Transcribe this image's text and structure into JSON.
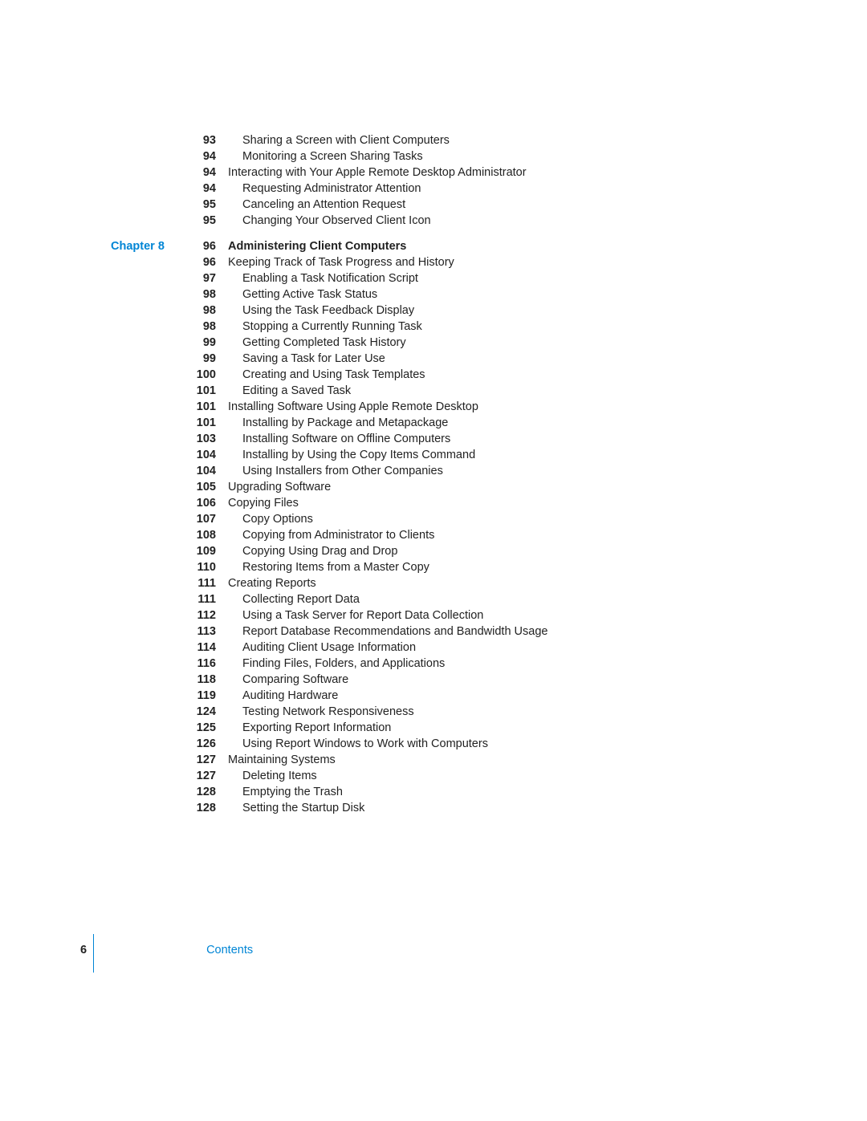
{
  "preEntries": [
    {
      "page": "93",
      "title": "Sharing a Screen with Client Computers",
      "indent": 2
    },
    {
      "page": "94",
      "title": "Monitoring a Screen Sharing Tasks",
      "indent": 2
    },
    {
      "page": "94",
      "title": "Interacting with Your Apple Remote Desktop Administrator",
      "indent": 1
    },
    {
      "page": "94",
      "title": "Requesting Administrator Attention",
      "indent": 2
    },
    {
      "page": "95",
      "title": "Canceling an Attention Request",
      "indent": 2
    },
    {
      "page": "95",
      "title": "Changing Your Observed Client Icon",
      "indent": 2
    }
  ],
  "chapter": {
    "label": "Chapter 8",
    "page": "96",
    "title": "Administering Client Computers"
  },
  "entries": [
    {
      "page": "96",
      "title": "Keeping Track of Task Progress and History",
      "indent": 1
    },
    {
      "page": "97",
      "title": "Enabling a Task Notification Script",
      "indent": 2
    },
    {
      "page": "98",
      "title": "Getting Active Task Status",
      "indent": 2
    },
    {
      "page": "98",
      "title": "Using the Task Feedback Display",
      "indent": 2
    },
    {
      "page": "98",
      "title": "Stopping a Currently Running Task",
      "indent": 2
    },
    {
      "page": "99",
      "title": "Getting Completed Task History",
      "indent": 2
    },
    {
      "page": "99",
      "title": "Saving a Task for Later Use",
      "indent": 2
    },
    {
      "page": "100",
      "title": "Creating and Using Task Templates",
      "indent": 2
    },
    {
      "page": "101",
      "title": "Editing a Saved Task",
      "indent": 2
    },
    {
      "page": "101",
      "title": "Installing Software Using Apple Remote Desktop",
      "indent": 1
    },
    {
      "page": "101",
      "title": "Installing by Package and Metapackage",
      "indent": 2
    },
    {
      "page": "103",
      "title": "Installing Software on Offline Computers",
      "indent": 2
    },
    {
      "page": "104",
      "title": "Installing by Using the Copy Items Command",
      "indent": 2
    },
    {
      "page": "104",
      "title": "Using Installers from Other Companies",
      "indent": 2
    },
    {
      "page": "105",
      "title": "Upgrading Software",
      "indent": 1
    },
    {
      "page": "106",
      "title": "Copying Files",
      "indent": 1
    },
    {
      "page": "107",
      "title": "Copy Options",
      "indent": 2
    },
    {
      "page": "108",
      "title": "Copying from Administrator to Clients",
      "indent": 2
    },
    {
      "page": "109",
      "title": "Copying Using Drag and Drop",
      "indent": 2
    },
    {
      "page": "110",
      "title": "Restoring Items from a Master Copy",
      "indent": 2
    },
    {
      "page": "111",
      "title": "Creating Reports",
      "indent": 1
    },
    {
      "page": "111",
      "title": "Collecting Report Data",
      "indent": 2
    },
    {
      "page": "112",
      "title": "Using a Task Server for Report Data Collection",
      "indent": 2
    },
    {
      "page": "113",
      "title": "Report Database Recommendations and Bandwidth Usage",
      "indent": 2
    },
    {
      "page": "114",
      "title": "Auditing Client Usage Information",
      "indent": 2
    },
    {
      "page": "116",
      "title": "Finding Files, Folders, and Applications",
      "indent": 2
    },
    {
      "page": "118",
      "title": "Comparing Software",
      "indent": 2
    },
    {
      "page": "119",
      "title": "Auditing Hardware",
      "indent": 2
    },
    {
      "page": "124",
      "title": "Testing Network Responsiveness",
      "indent": 2
    },
    {
      "page": "125",
      "title": "Exporting Report Information",
      "indent": 2
    },
    {
      "page": "126",
      "title": "Using Report Windows to Work with Computers",
      "indent": 2
    },
    {
      "page": "127",
      "title": "Maintaining Systems",
      "indent": 1
    },
    {
      "page": "127",
      "title": "Deleting Items",
      "indent": 2
    },
    {
      "page": "128",
      "title": "Emptying the Trash",
      "indent": 2
    },
    {
      "page": "128",
      "title": "Setting the Startup Disk",
      "indent": 2
    }
  ],
  "footer": {
    "pageNumber": "6",
    "label": "Contents"
  }
}
